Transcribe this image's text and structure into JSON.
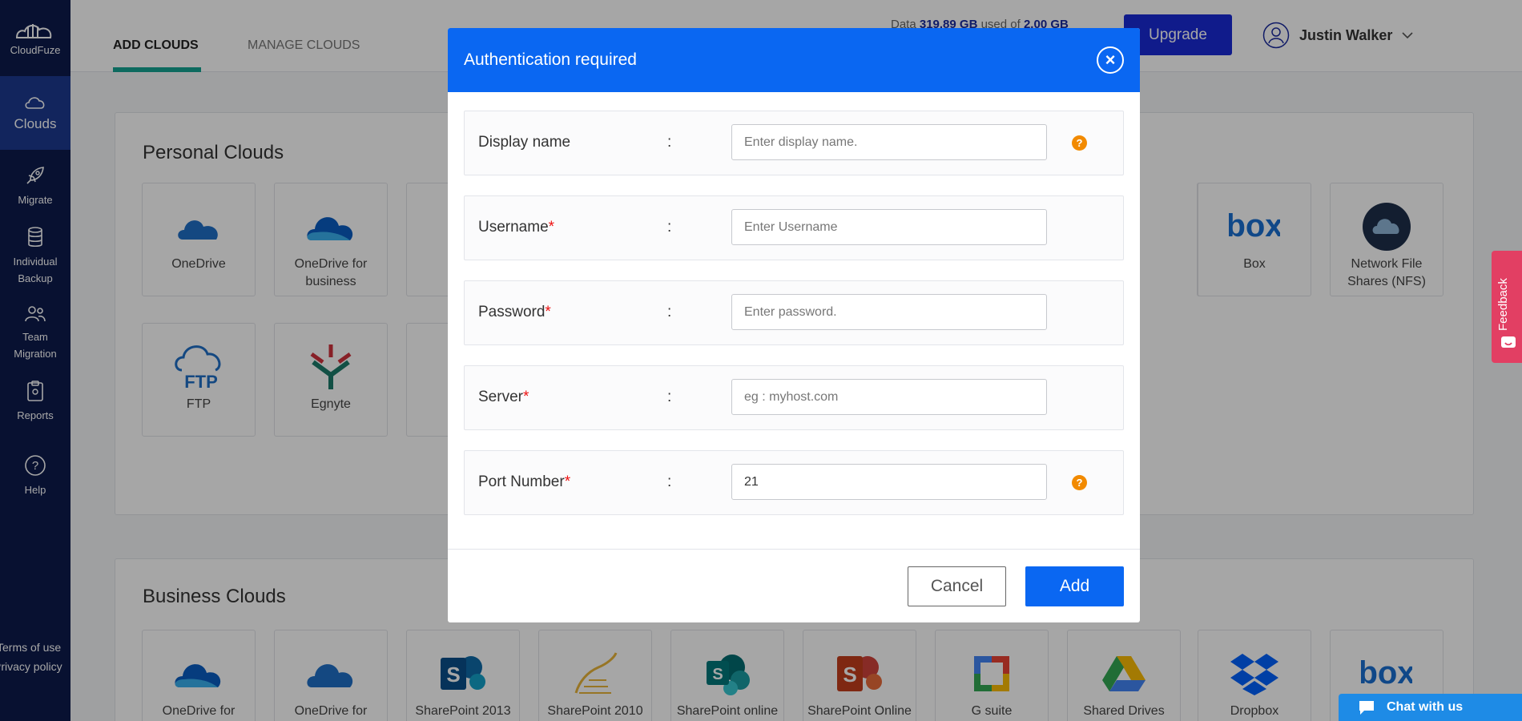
{
  "sidebar": {
    "logo": "CloudFuze",
    "items": [
      {
        "label": "Clouds",
        "icon": "cloud-icon"
      },
      {
        "label": "Migrate",
        "icon": "rocket-icon"
      },
      {
        "label": "Individual Backup",
        "icon": "database-icon"
      },
      {
        "label": "Team Migration",
        "icon": "users-icon"
      },
      {
        "label": "Reports",
        "icon": "clipboard-icon"
      },
      {
        "label": "Help",
        "icon": "help-icon"
      }
    ],
    "footer": [
      "Terms of use",
      "Privacy policy"
    ]
  },
  "header": {
    "tabs": [
      {
        "label": "ADD CLOUDS",
        "active": true
      },
      {
        "label": "MANAGE CLOUDS",
        "active": false
      }
    ],
    "data_usage": {
      "prefix": "Data",
      "used": "319.89 GB",
      "middle": "used of",
      "total": "2.00 GB"
    },
    "upgrade_label": "Upgrade",
    "user_name": "Justin Walker"
  },
  "personal_clouds": {
    "title": "Personal Clouds",
    "items": [
      {
        "label": "OneDrive",
        "icon": "onedrive-icon"
      },
      {
        "label": "OneDrive for business",
        "icon": "onedrive-business-icon"
      },
      {
        "label": "Box",
        "icon": "box-icon"
      },
      {
        "label": "Network File Shares (NFS)",
        "icon": "nfs-icon"
      },
      {
        "label": "FTP",
        "icon": "ftp-icon"
      },
      {
        "label": "Egnyte",
        "icon": "egnyte-icon"
      }
    ]
  },
  "business_clouds": {
    "title": "Business Clouds",
    "items": [
      {
        "label": "OneDrive for business",
        "icon": "onedrive-business-icon"
      },
      {
        "label": "OneDrive for business hybrid",
        "icon": "onedrive-hybrid-icon"
      },
      {
        "label": "SharePoint 2013",
        "icon": "sharepoint-icon"
      },
      {
        "label": "SharePoint 2010",
        "icon": "sharepoint-2010-icon"
      },
      {
        "label": "SharePoint online",
        "icon": "sharepoint-online-icon"
      },
      {
        "label": "SharePoint Online Hybrid",
        "icon": "sharepoint-hybrid-icon"
      },
      {
        "label": "G suite",
        "icon": "gsuite-icon"
      },
      {
        "label": "Shared Drives",
        "icon": "google-drive-icon"
      },
      {
        "label": "Dropbox",
        "icon": "dropbox-icon"
      },
      {
        "label": "",
        "icon": "box-icon"
      }
    ]
  },
  "feedback_label": "Feedback",
  "chat_label": "Chat with us",
  "modal": {
    "title": "Authentication required",
    "fields": [
      {
        "label": "Display name",
        "required": false,
        "placeholder": "Enter display name.",
        "value": "",
        "help": true
      },
      {
        "label": "Username",
        "required": true,
        "placeholder": "Enter Username",
        "value": "",
        "help": false
      },
      {
        "label": "Password",
        "required": true,
        "placeholder": "Enter password.",
        "value": "",
        "help": false
      },
      {
        "label": "Server",
        "required": true,
        "placeholder": "eg : myhost.com",
        "value": "",
        "help": false
      },
      {
        "label": "Port Number",
        "required": true,
        "placeholder": "",
        "value": "21",
        "help": true
      }
    ],
    "colon": ":",
    "required_mark": "*",
    "help_mark": "?",
    "cancel_label": "Cancel",
    "add_label": "Add"
  }
}
